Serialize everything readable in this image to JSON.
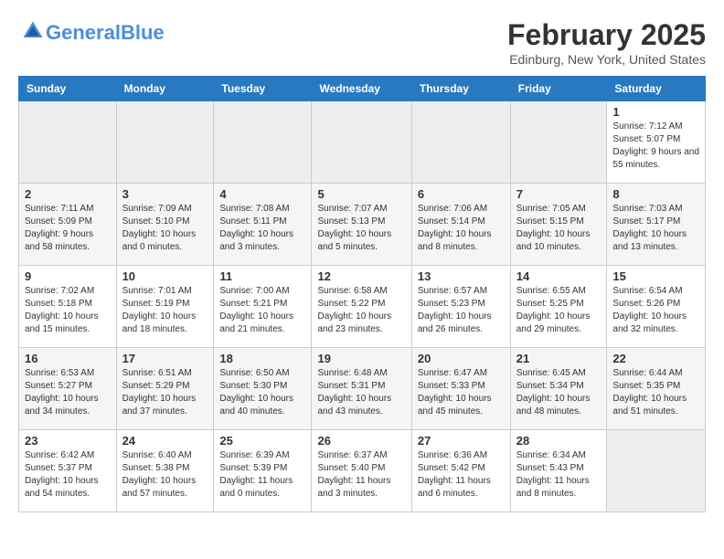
{
  "header": {
    "logo_line1": "General",
    "logo_line2": "Blue",
    "month_title": "February 2025",
    "location": "Edinburg, New York, United States"
  },
  "days_of_week": [
    "Sunday",
    "Monday",
    "Tuesday",
    "Wednesday",
    "Thursday",
    "Friday",
    "Saturday"
  ],
  "weeks": [
    [
      {
        "day": null
      },
      {
        "day": null
      },
      {
        "day": null
      },
      {
        "day": null
      },
      {
        "day": null
      },
      {
        "day": null
      },
      {
        "day": 1,
        "sunrise": "Sunrise: 7:12 AM",
        "sunset": "Sunset: 5:07 PM",
        "daylight": "Daylight: 9 hours and 55 minutes."
      }
    ],
    [
      {
        "day": 2,
        "sunrise": "Sunrise: 7:11 AM",
        "sunset": "Sunset: 5:09 PM",
        "daylight": "Daylight: 9 hours and 58 minutes."
      },
      {
        "day": 3,
        "sunrise": "Sunrise: 7:09 AM",
        "sunset": "Sunset: 5:10 PM",
        "daylight": "Daylight: 10 hours and 0 minutes."
      },
      {
        "day": 4,
        "sunrise": "Sunrise: 7:08 AM",
        "sunset": "Sunset: 5:11 PM",
        "daylight": "Daylight: 10 hours and 3 minutes."
      },
      {
        "day": 5,
        "sunrise": "Sunrise: 7:07 AM",
        "sunset": "Sunset: 5:13 PM",
        "daylight": "Daylight: 10 hours and 5 minutes."
      },
      {
        "day": 6,
        "sunrise": "Sunrise: 7:06 AM",
        "sunset": "Sunset: 5:14 PM",
        "daylight": "Daylight: 10 hours and 8 minutes."
      },
      {
        "day": 7,
        "sunrise": "Sunrise: 7:05 AM",
        "sunset": "Sunset: 5:15 PM",
        "daylight": "Daylight: 10 hours and 10 minutes."
      },
      {
        "day": 8,
        "sunrise": "Sunrise: 7:03 AM",
        "sunset": "Sunset: 5:17 PM",
        "daylight": "Daylight: 10 hours and 13 minutes."
      }
    ],
    [
      {
        "day": 9,
        "sunrise": "Sunrise: 7:02 AM",
        "sunset": "Sunset: 5:18 PM",
        "daylight": "Daylight: 10 hours and 15 minutes."
      },
      {
        "day": 10,
        "sunrise": "Sunrise: 7:01 AM",
        "sunset": "Sunset: 5:19 PM",
        "daylight": "Daylight: 10 hours and 18 minutes."
      },
      {
        "day": 11,
        "sunrise": "Sunrise: 7:00 AM",
        "sunset": "Sunset: 5:21 PM",
        "daylight": "Daylight: 10 hours and 21 minutes."
      },
      {
        "day": 12,
        "sunrise": "Sunrise: 6:58 AM",
        "sunset": "Sunset: 5:22 PM",
        "daylight": "Daylight: 10 hours and 23 minutes."
      },
      {
        "day": 13,
        "sunrise": "Sunrise: 6:57 AM",
        "sunset": "Sunset: 5:23 PM",
        "daylight": "Daylight: 10 hours and 26 minutes."
      },
      {
        "day": 14,
        "sunrise": "Sunrise: 6:55 AM",
        "sunset": "Sunset: 5:25 PM",
        "daylight": "Daylight: 10 hours and 29 minutes."
      },
      {
        "day": 15,
        "sunrise": "Sunrise: 6:54 AM",
        "sunset": "Sunset: 5:26 PM",
        "daylight": "Daylight: 10 hours and 32 minutes."
      }
    ],
    [
      {
        "day": 16,
        "sunrise": "Sunrise: 6:53 AM",
        "sunset": "Sunset: 5:27 PM",
        "daylight": "Daylight: 10 hours and 34 minutes."
      },
      {
        "day": 17,
        "sunrise": "Sunrise: 6:51 AM",
        "sunset": "Sunset: 5:29 PM",
        "daylight": "Daylight: 10 hours and 37 minutes."
      },
      {
        "day": 18,
        "sunrise": "Sunrise: 6:50 AM",
        "sunset": "Sunset: 5:30 PM",
        "daylight": "Daylight: 10 hours and 40 minutes."
      },
      {
        "day": 19,
        "sunrise": "Sunrise: 6:48 AM",
        "sunset": "Sunset: 5:31 PM",
        "daylight": "Daylight: 10 hours and 43 minutes."
      },
      {
        "day": 20,
        "sunrise": "Sunrise: 6:47 AM",
        "sunset": "Sunset: 5:33 PM",
        "daylight": "Daylight: 10 hours and 45 minutes."
      },
      {
        "day": 21,
        "sunrise": "Sunrise: 6:45 AM",
        "sunset": "Sunset: 5:34 PM",
        "daylight": "Daylight: 10 hours and 48 minutes."
      },
      {
        "day": 22,
        "sunrise": "Sunrise: 6:44 AM",
        "sunset": "Sunset: 5:35 PM",
        "daylight": "Daylight: 10 hours and 51 minutes."
      }
    ],
    [
      {
        "day": 23,
        "sunrise": "Sunrise: 6:42 AM",
        "sunset": "Sunset: 5:37 PM",
        "daylight": "Daylight: 10 hours and 54 minutes."
      },
      {
        "day": 24,
        "sunrise": "Sunrise: 6:40 AM",
        "sunset": "Sunset: 5:38 PM",
        "daylight": "Daylight: 10 hours and 57 minutes."
      },
      {
        "day": 25,
        "sunrise": "Sunrise: 6:39 AM",
        "sunset": "Sunset: 5:39 PM",
        "daylight": "Daylight: 11 hours and 0 minutes."
      },
      {
        "day": 26,
        "sunrise": "Sunrise: 6:37 AM",
        "sunset": "Sunset: 5:40 PM",
        "daylight": "Daylight: 11 hours and 3 minutes."
      },
      {
        "day": 27,
        "sunrise": "Sunrise: 6:36 AM",
        "sunset": "Sunset: 5:42 PM",
        "daylight": "Daylight: 11 hours and 6 minutes."
      },
      {
        "day": 28,
        "sunrise": "Sunrise: 6:34 AM",
        "sunset": "Sunset: 5:43 PM",
        "daylight": "Daylight: 11 hours and 8 minutes."
      },
      {
        "day": null
      }
    ]
  ]
}
